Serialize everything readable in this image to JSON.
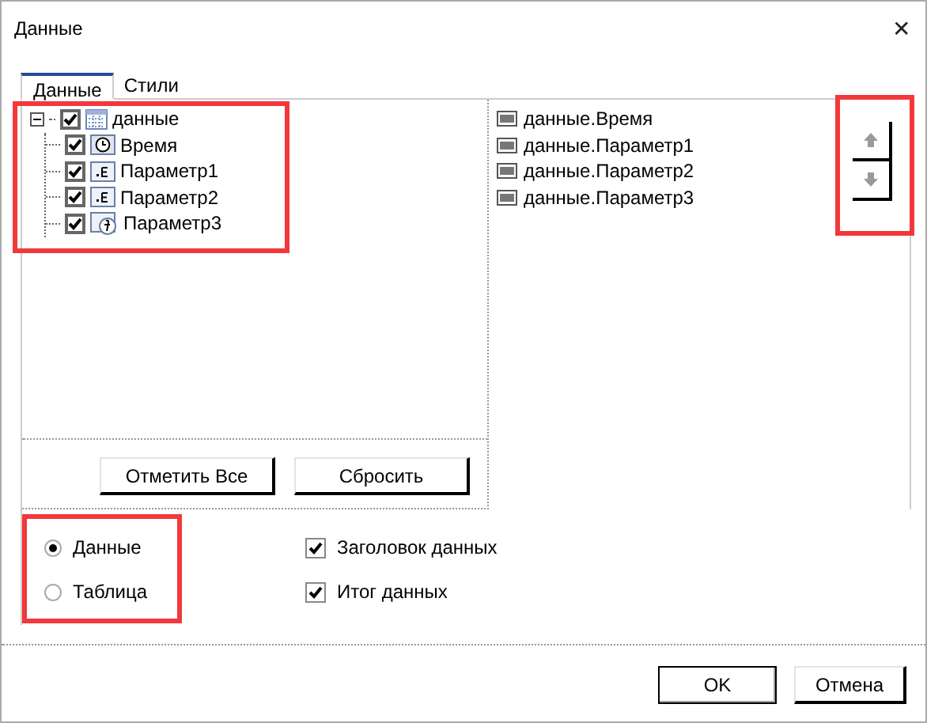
{
  "window": {
    "title": "Данные",
    "close": "✕"
  },
  "tabs": [
    {
      "label": "Данные",
      "selected": true
    },
    {
      "label": "Стили",
      "selected": false
    }
  ],
  "tree": {
    "label": "данные",
    "checked": true,
    "expanded": true,
    "children": [
      {
        "label": "Время",
        "checked": true,
        "kind": "clock"
      },
      {
        "label": "Параметр1",
        "checked": true,
        "kind": "number"
      },
      {
        "label": "Параметр2",
        "checked": true,
        "kind": "number"
      },
      {
        "label": "Параметр3",
        "checked": true,
        "kind": "formula"
      }
    ]
  },
  "tree_buttons": [
    "Отметить Все",
    "Сбросить"
  ],
  "fields": [
    {
      "label": "данные.Время"
    },
    {
      "label": "данные.Параметр1"
    },
    {
      "label": "данные.Параметр2"
    },
    {
      "label": "данные.Параметр3"
    }
  ],
  "mode": [
    {
      "label": "Данные",
      "selected": true
    },
    {
      "label": "Таблица",
      "selected": false
    }
  ],
  "options": [
    {
      "label": "Заголовок данных",
      "checked": true
    },
    {
      "label": "Итог данных",
      "checked": true
    }
  ],
  "buttons": [
    {
      "label": "OK",
      "default": true
    },
    {
      "label": "Отмена",
      "default": false
    }
  ]
}
